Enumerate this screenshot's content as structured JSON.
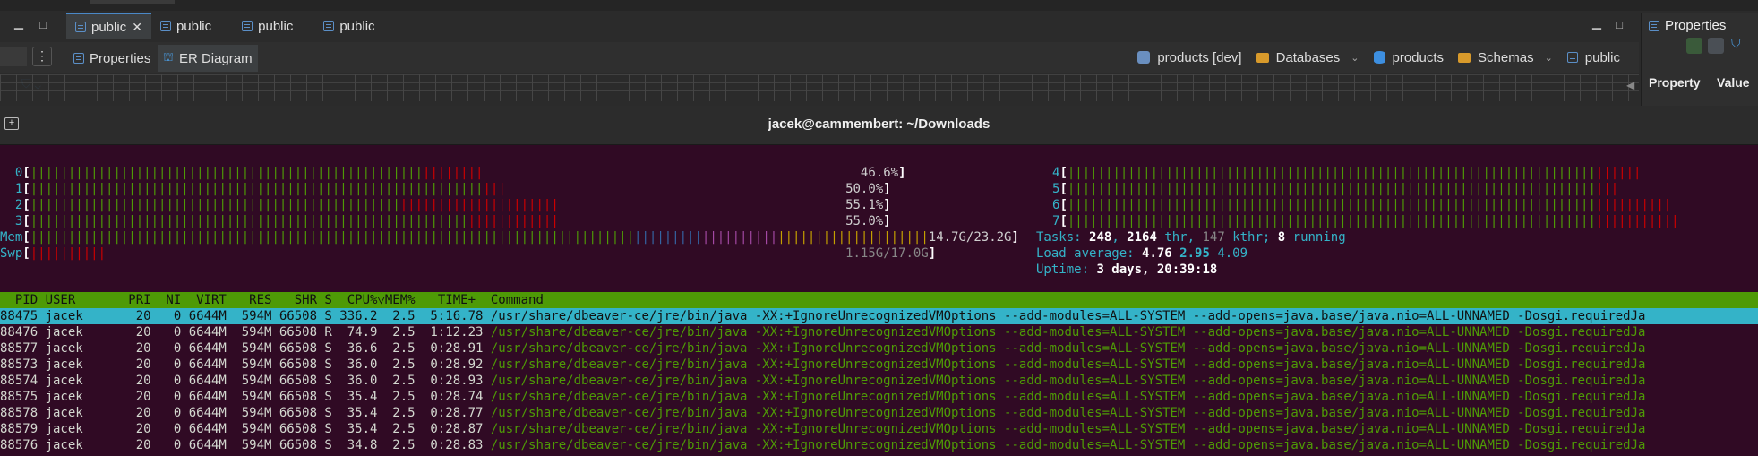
{
  "app": {
    "editor_tabs": [
      {
        "label": "public",
        "active": true,
        "closable": true
      },
      {
        "label": "public",
        "active": false
      },
      {
        "label": "public",
        "active": false
      },
      {
        "label": "public",
        "active": false
      }
    ],
    "sub_tabs": [
      {
        "label": "Properties",
        "active": false
      },
      {
        "label": "ER Diagram",
        "active": true
      }
    ],
    "breadcrumb": [
      {
        "label": "products [dev]",
        "icon": "connection-icon"
      },
      {
        "label": "Databases",
        "icon": "folder-icon",
        "dropdown": true
      },
      {
        "label": "products",
        "icon": "database-icon"
      },
      {
        "label": "Schemas",
        "icon": "folder-icon",
        "dropdown": true
      },
      {
        "label": "public",
        "icon": "schema-icon"
      }
    ],
    "properties_panel": {
      "title": "Properties",
      "columns": [
        "Property",
        "Value"
      ]
    }
  },
  "terminal": {
    "title": "jacek@cammembert: ~/Downloads",
    "cpus": [
      {
        "id": "0",
        "percent": "46.6%"
      },
      {
        "id": "1",
        "percent": "50.0%"
      },
      {
        "id": "2",
        "percent": "55.1%"
      },
      {
        "id": "3",
        "percent": "55.0%"
      },
      {
        "id": "4",
        "percent": ""
      },
      {
        "id": "5",
        "percent": ""
      },
      {
        "id": "6",
        "percent": ""
      },
      {
        "id": "7",
        "percent": ""
      }
    ],
    "mem": {
      "label": "Mem",
      "value": "14.7G/23.2G"
    },
    "swp": {
      "label": "Swp",
      "value": "1.15G/17.0G"
    },
    "tasks": {
      "prefix": "Tasks: ",
      "tasks": "248",
      "thr": "2164",
      "kthr": "147",
      "running": "8"
    },
    "load": {
      "prefix": "Load average: ",
      "l1": "4.76",
      "l5": "2.95",
      "l15": "4.09"
    },
    "uptime": {
      "prefix": "Uptime: ",
      "value": "3 days, 20:39:18"
    },
    "columns": "  PID USER       PRI  NI  VIRT   RES   SHR S  CPU%▽MEM%   TIME+  Command",
    "processes": [
      {
        "pid": "88475",
        "user": "jacek",
        "pri": "20",
        "ni": "0",
        "virt": "6644M",
        "res": "594M",
        "shr": "66508",
        "s": "S",
        "cpu": "336.2",
        "mem": "2.5",
        "time": "5:16.78",
        "cmd": "/usr/share/dbeaver-ce/jre/bin/java -XX:+IgnoreUnrecognizedVMOptions --add-modules=ALL-SYSTEM --add-opens=java.base/java.nio=ALL-UNNAMED -Dosgi.requiredJa",
        "selected": true
      },
      {
        "pid": "88476",
        "user": "jacek",
        "pri": "20",
        "ni": "0",
        "virt": "6644M",
        "res": "594M",
        "shr": "66508",
        "s": "R",
        "cpu": "74.9",
        "mem": "2.5",
        "time": "1:12.23",
        "cmd": "/usr/share/dbeaver-ce/jre/bin/java -XX:+IgnoreUnrecognizedVMOptions --add-modules=ALL-SYSTEM --add-opens=java.base/java.nio=ALL-UNNAMED -Dosgi.requiredJa"
      },
      {
        "pid": "88577",
        "user": "jacek",
        "pri": "20",
        "ni": "0",
        "virt": "6644M",
        "res": "594M",
        "shr": "66508",
        "s": "S",
        "cpu": "36.6",
        "mem": "2.5",
        "time": "0:28.91",
        "cmd": "/usr/share/dbeaver-ce/jre/bin/java -XX:+IgnoreUnrecognizedVMOptions --add-modules=ALL-SYSTEM --add-opens=java.base/java.nio=ALL-UNNAMED -Dosgi.requiredJa"
      },
      {
        "pid": "88573",
        "user": "jacek",
        "pri": "20",
        "ni": "0",
        "virt": "6644M",
        "res": "594M",
        "shr": "66508",
        "s": "S",
        "cpu": "36.0",
        "mem": "2.5",
        "time": "0:28.92",
        "cmd": "/usr/share/dbeaver-ce/jre/bin/java -XX:+IgnoreUnrecognizedVMOptions --add-modules=ALL-SYSTEM --add-opens=java.base/java.nio=ALL-UNNAMED -Dosgi.requiredJa"
      },
      {
        "pid": "88574",
        "user": "jacek",
        "pri": "20",
        "ni": "0",
        "virt": "6644M",
        "res": "594M",
        "shr": "66508",
        "s": "S",
        "cpu": "36.0",
        "mem": "2.5",
        "time": "0:28.93",
        "cmd": "/usr/share/dbeaver-ce/jre/bin/java -XX:+IgnoreUnrecognizedVMOptions --add-modules=ALL-SYSTEM --add-opens=java.base/java.nio=ALL-UNNAMED -Dosgi.requiredJa"
      },
      {
        "pid": "88575",
        "user": "jacek",
        "pri": "20",
        "ni": "0",
        "virt": "6644M",
        "res": "594M",
        "shr": "66508",
        "s": "S",
        "cpu": "35.4",
        "mem": "2.5",
        "time": "0:28.74",
        "cmd": "/usr/share/dbeaver-ce/jre/bin/java -XX:+IgnoreUnrecognizedVMOptions --add-modules=ALL-SYSTEM --add-opens=java.base/java.nio=ALL-UNNAMED -Dosgi.requiredJa"
      },
      {
        "pid": "88578",
        "user": "jacek",
        "pri": "20",
        "ni": "0",
        "virt": "6644M",
        "res": "594M",
        "shr": "66508",
        "s": "S",
        "cpu": "35.4",
        "mem": "2.5",
        "time": "0:28.77",
        "cmd": "/usr/share/dbeaver-ce/jre/bin/java -XX:+IgnoreUnrecognizedVMOptions --add-modules=ALL-SYSTEM --add-opens=java.base/java.nio=ALL-UNNAMED -Dosgi.requiredJa"
      },
      {
        "pid": "88579",
        "user": "jacek",
        "pri": "20",
        "ni": "0",
        "virt": "6644M",
        "res": "594M",
        "shr": "66508",
        "s": "S",
        "cpu": "35.4",
        "mem": "2.5",
        "time": "0:28.87",
        "cmd": "/usr/share/dbeaver-ce/jre/bin/java -XX:+IgnoreUnrecognizedVMOptions --add-modules=ALL-SYSTEM --add-opens=java.base/java.nio=ALL-UNNAMED -Dosgi.requiredJa"
      },
      {
        "pid": "88576",
        "user": "jacek",
        "pri": "20",
        "ni": "0",
        "virt": "6644M",
        "res": "594M",
        "shr": "66508",
        "s": "S",
        "cpu": "34.8",
        "mem": "2.5",
        "time": "0:28.83",
        "cmd": "/usr/share/dbeaver-ce/jre/bin/java -XX:+IgnoreUnrecognizedVMOptions --add-modules=ALL-SYSTEM --add-opens=java.base/java.nio=ALL-UNNAMED -Dosgi.requiredJa"
      }
    ]
  },
  "colors": {
    "terminal_bg": "#300a24",
    "header_green": "#4e9a06",
    "selection_cyan": "#34b3c8",
    "accent_blue": "#4a88c7"
  }
}
